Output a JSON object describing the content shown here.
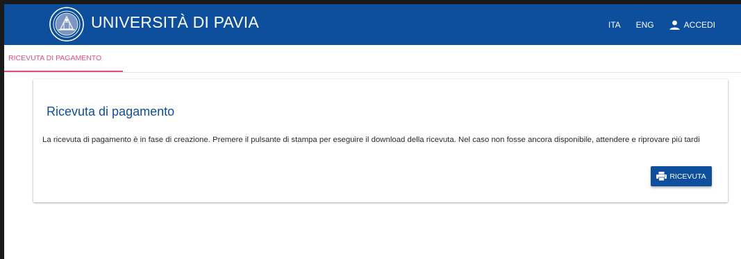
{
  "header": {
    "brand": "UNIVERSITÀ DI PAVIA",
    "nav": {
      "ita": "ITA",
      "eng": "ENG",
      "login": "ACCEDI"
    },
    "colors": {
      "bar": "#0d4f9c",
      "text": "#ffffff"
    },
    "icons": {
      "logo": "university-seal-icon",
      "login": "person-icon"
    }
  },
  "tabs": [
    {
      "label": "RICEVUTA DI PAGAMENTO",
      "active": true,
      "color": "#e54a88"
    }
  ],
  "card": {
    "title": "Ricevuta di pagamento",
    "text": "La ricevuta di pagamento è in fase di creazione. Premere il pulsante di stampa per eseguire il download della ricevuta. Nel caso non fosse ancora disponibile, attendere e riprovare più tardi",
    "button": {
      "label": "RICEVUTA",
      "icon": "printer-icon"
    }
  }
}
